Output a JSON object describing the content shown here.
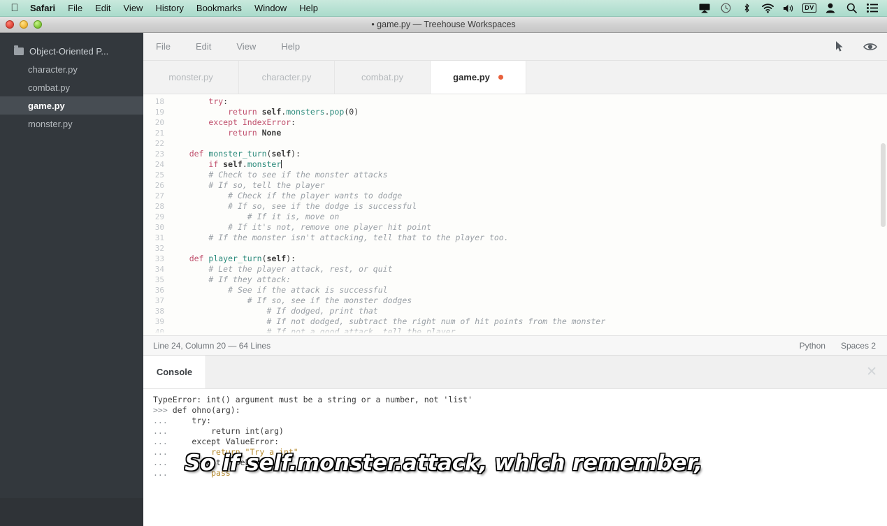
{
  "menubar": {
    "apple_icon": "apple-logo",
    "items": [
      {
        "label": "Safari",
        "bold": true
      },
      {
        "label": "File",
        "bold": false
      },
      {
        "label": "Edit",
        "bold": false
      },
      {
        "label": "View",
        "bold": false
      },
      {
        "label": "History",
        "bold": false
      },
      {
        "label": "Bookmarks",
        "bold": false
      },
      {
        "label": "Window",
        "bold": false
      },
      {
        "label": "Help",
        "bold": false
      }
    ],
    "status_icons": [
      "airplay-icon",
      "time-machine-icon",
      "bluetooth-icon",
      "wifi-icon",
      "volume-icon",
      "dv-badge-icon",
      "user-account-icon",
      "spotlight-search-icon",
      "notification-center-icon"
    ],
    "dv_badge_label": "DV",
    "bg_color": "#b9e2d4"
  },
  "window": {
    "title": "• game.py — Treehouse Workspaces",
    "traffic_lights": [
      "close-button",
      "minimize-button",
      "zoom-button"
    ]
  },
  "sidebar": {
    "project": {
      "label": "Object-Oriented P...",
      "icon": "folder-icon"
    },
    "files": [
      {
        "label": "character.py",
        "active": false
      },
      {
        "label": "combat.py",
        "active": false
      },
      {
        "label": "game.py",
        "active": true
      },
      {
        "label": "monster.py",
        "active": false
      }
    ],
    "bg_color": "#33383d",
    "active_color": "#474d53"
  },
  "editor": {
    "menu": [
      "File",
      "Edit",
      "View",
      "Help"
    ],
    "right_icons": [
      "pointer-cursor-icon",
      "eye-preview-icon"
    ],
    "tabs": [
      {
        "label": "monster.py",
        "active": false,
        "modified": false
      },
      {
        "label": "character.py",
        "active": false,
        "modified": false
      },
      {
        "label": "combat.py",
        "active": false,
        "modified": false
      },
      {
        "label": "game.py",
        "active": true,
        "modified": true
      }
    ],
    "modified_dot_color": "#e8603c",
    "code_lines": [
      {
        "n": "18",
        "indent": 2,
        "tokens": [
          {
            "t": "try",
            "c": "kw"
          },
          {
            "t": ":",
            "c": "ctext"
          }
        ]
      },
      {
        "n": "19",
        "indent": 3,
        "tokens": [
          {
            "t": "return ",
            "c": "kw"
          },
          {
            "t": "self",
            "c": "sf"
          },
          {
            "t": ".",
            "c": "ctext"
          },
          {
            "t": "monsters",
            "c": "bi"
          },
          {
            "t": ".",
            "c": "ctext"
          },
          {
            "t": "pop",
            "c": "bi"
          },
          {
            "t": "(",
            "c": "ctext"
          },
          {
            "t": "0",
            "c": "num"
          },
          {
            "t": ")",
            "c": "ctext"
          }
        ]
      },
      {
        "n": "20",
        "indent": 2,
        "tokens": [
          {
            "t": "except ",
            "c": "kw"
          },
          {
            "t": "IndexError",
            "c": "cls"
          },
          {
            "t": ":",
            "c": "ctext"
          }
        ]
      },
      {
        "n": "21",
        "indent": 3,
        "tokens": [
          {
            "t": "return ",
            "c": "kw"
          },
          {
            "t": "None",
            "c": "sf"
          }
        ]
      },
      {
        "n": "22",
        "indent": 0,
        "tokens": []
      },
      {
        "n": "23",
        "indent": 1,
        "tokens": [
          {
            "t": "def ",
            "c": "kw"
          },
          {
            "t": "monster_turn",
            "c": "bi"
          },
          {
            "t": "(",
            "c": "ctext"
          },
          {
            "t": "self",
            "c": "sf"
          },
          {
            "t": "):",
            "c": "ctext"
          }
        ]
      },
      {
        "n": "24",
        "indent": 2,
        "tokens": [
          {
            "t": "if ",
            "c": "kw"
          },
          {
            "t": "self",
            "c": "sf"
          },
          {
            "t": ".",
            "c": "ctext"
          },
          {
            "t": "monster",
            "c": "bi"
          }
        ],
        "cursor": true
      },
      {
        "n": "25",
        "indent": 2,
        "tokens": [
          {
            "t": "# Check to see if the monster attacks",
            "c": "cm"
          }
        ]
      },
      {
        "n": "26",
        "indent": 2,
        "tokens": [
          {
            "t": "# If so, tell the player",
            "c": "cm"
          }
        ]
      },
      {
        "n": "27",
        "indent": 3,
        "tokens": [
          {
            "t": "# Check if the player wants to dodge",
            "c": "cm"
          }
        ]
      },
      {
        "n": "28",
        "indent": 3,
        "tokens": [
          {
            "t": "# If so, see if the dodge is successful",
            "c": "cm"
          }
        ]
      },
      {
        "n": "29",
        "indent": 4,
        "tokens": [
          {
            "t": "# If it is, move on",
            "c": "cm"
          }
        ]
      },
      {
        "n": "30",
        "indent": 3,
        "tokens": [
          {
            "t": "# If it's not, remove one player hit point",
            "c": "cm"
          }
        ]
      },
      {
        "n": "31",
        "indent": 2,
        "tokens": [
          {
            "t": "# If the monster isn't attacking, tell that to the player too.",
            "c": "cm"
          }
        ]
      },
      {
        "n": "32",
        "indent": 0,
        "tokens": []
      },
      {
        "n": "33",
        "indent": 1,
        "tokens": [
          {
            "t": "def ",
            "c": "kw"
          },
          {
            "t": "player_turn",
            "c": "bi"
          },
          {
            "t": "(",
            "c": "ctext"
          },
          {
            "t": "self",
            "c": "sf"
          },
          {
            "t": "):",
            "c": "ctext"
          }
        ]
      },
      {
        "n": "34",
        "indent": 2,
        "tokens": [
          {
            "t": "# Let the player attack, rest, or quit",
            "c": "cm"
          }
        ]
      },
      {
        "n": "35",
        "indent": 2,
        "tokens": [
          {
            "t": "# If they attack:",
            "c": "cm"
          }
        ]
      },
      {
        "n": "36",
        "indent": 3,
        "tokens": [
          {
            "t": "# See if the attack is successful",
            "c": "cm"
          }
        ]
      },
      {
        "n": "37",
        "indent": 4,
        "tokens": [
          {
            "t": "# If so, see if the monster dodges",
            "c": "cm"
          }
        ]
      },
      {
        "n": "38",
        "indent": 5,
        "tokens": [
          {
            "t": "# If dodged, print that",
            "c": "cm"
          }
        ]
      },
      {
        "n": "39",
        "indent": 5,
        "tokens": [
          {
            "t": "# If not dodged, subtract the right num of hit points from the monster",
            "c": "cm"
          }
        ]
      },
      {
        "n": "40",
        "indent": 5,
        "tokens": [
          {
            "t": "# If not a good attack, tell the player",
            "c": "cm"
          }
        ]
      }
    ],
    "status": {
      "position": "Line 24, Column 20 — 64 Lines",
      "language": "Python",
      "indent_label": "Spaces",
      "indent_size": "2"
    }
  },
  "console": {
    "tab_label": "Console",
    "close_icon": "close-icon",
    "lines": [
      [
        {
          "t": "TypeError: int() argument must be a string or a number, not 'list'",
          "c": "cerr"
        }
      ],
      [
        {
          "t": ">>> ",
          "c": "cprompt"
        },
        {
          "t": "def ohno(arg):",
          "c": "cerr"
        }
      ],
      [
        {
          "t": "... ",
          "c": "cprompt"
        },
        {
          "t": "    try:",
          "c": "cerr"
        }
      ],
      [
        {
          "t": "... ",
          "c": "cprompt"
        },
        {
          "t": "        return int(arg)",
          "c": "cerr"
        }
      ],
      [
        {
          "t": "... ",
          "c": "cprompt"
        },
        {
          "t": "    except ValueError:",
          "c": "cerr"
        }
      ],
      [
        {
          "t": "... ",
          "c": "cprompt"
        },
        {
          "t": "        return \"Try a int\"",
          "c": "cstr"
        }
      ],
      [
        {
          "t": "... ",
          "c": "cprompt"
        },
        {
          "t": "    except TypeError:",
          "c": "cerr"
        }
      ],
      [
        {
          "t": "... ",
          "c": "cprompt"
        },
        {
          "t": "        pass",
          "c": "ckw"
        }
      ]
    ]
  },
  "subtitle": {
    "text": "So if self.monster.attack, which remember,"
  }
}
